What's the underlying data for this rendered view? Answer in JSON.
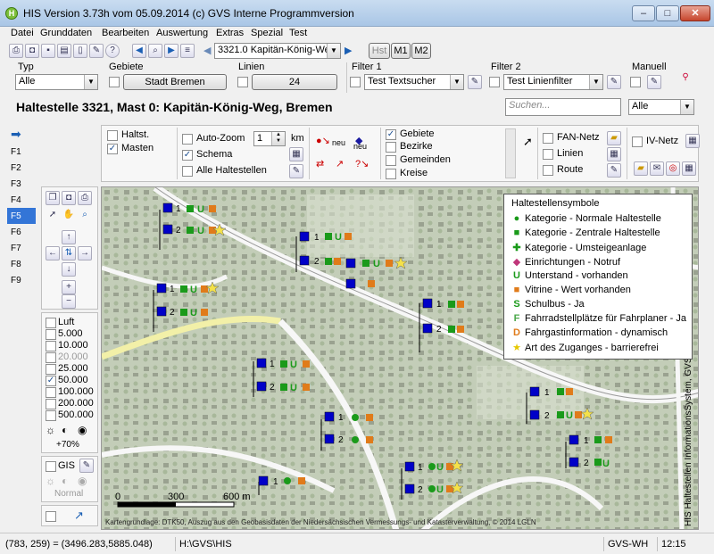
{
  "window": {
    "title": "HIS Version 3.73h vom 05.09.2014 (c) GVS Interne Programmversion",
    "icon_letter": "H",
    "controls": [
      "minimize-icon",
      "maximize-icon",
      "close-icon"
    ]
  },
  "menu": [
    "Datei",
    "Grunddaten",
    "Bearbeiten",
    "Auswertung",
    "Extras",
    "Spezial",
    "Test"
  ],
  "toolbar": {
    "stop_combo": "3321.0 Kapitän-König-Weg",
    "hst_label": "Hst",
    "m1_label": "M1",
    "m2_label": "M2"
  },
  "filters": {
    "typ_label": "Typ",
    "typ_value": "Alle",
    "gebiete_label": "Gebiete",
    "gebiete_button": "Stadt Bremen",
    "linien_label": "Linien",
    "linien_button": "24",
    "filter1_label": "Filter 1",
    "filter1_value": "Test Textsucher",
    "filter2_label": "Filter 2",
    "filter2_value": "Test Linienfilter",
    "manuell_label": "Manuell"
  },
  "heading": {
    "title": "Haltestelle 3321, Mast 0: Kapitän-König-Weg, Bremen",
    "search_placeholder": "Suchen...",
    "search_scope": "Alle"
  },
  "options": {
    "haltst": "Haltst.",
    "masten": "Masten",
    "autozoom": "Auto-Zoom",
    "zoom_value": "1",
    "zoom_unit": "km",
    "schema": "Schema",
    "alle_haltestellen": "Alle Haltestellen",
    "neu1": "neu",
    "neu2": "neu",
    "gebiete": "Gebiete",
    "bezirke": "Bezirke",
    "gemeinden": "Gemeinden",
    "kreise": "Kreise",
    "fan_netz": "FAN-Netz",
    "linien": "Linien",
    "route": "Route",
    "iv_netz": "IV-Netz"
  },
  "fkeys": [
    "F1",
    "F2",
    "F3",
    "F4",
    "F5",
    "F6",
    "F7",
    "F8",
    "F9"
  ],
  "active_fkey": "F5",
  "layers": [
    "Luft",
    "5.000",
    "10.000",
    "20.000",
    "25.000",
    "50.000",
    "100.000",
    "200.000",
    "500.000"
  ],
  "brightness": "+70%",
  "gis": {
    "label": "GIS",
    "mode": "Normal"
  },
  "map": {
    "scale_labels": [
      "0",
      "300",
      "600 m"
    ],
    "credit": "Kartengrundlage: DTK50, Auszug aus den Geobasisdaten der Niedersächsischen Vermessungs- und Katasterverwaltung, © 2014 LGLN",
    "side_text": "HIS Haltestellen InformationsSystem, GVS",
    "stop_numbers": [
      "1",
      "2"
    ],
    "colors": {
      "mast": "#0000c8",
      "unterstand": "#1a9a1a",
      "vitrine": "#e07b1a",
      "zugang": "#f4e14a"
    }
  },
  "legend": {
    "title": "Haltestellensymbole",
    "items": [
      {
        "icon": "green-circle-icon",
        "label": "Kategorie - Normale Haltestelle"
      },
      {
        "icon": "green-square-icon",
        "label": "Kategorie - Zentrale Haltestelle"
      },
      {
        "icon": "green-cross-icon",
        "label": "Kategorie - Umsteigeanlage"
      },
      {
        "icon": "pink-diamond-icon",
        "label": "Einrichtungen - Notruf"
      },
      {
        "symbol": "U",
        "label": "Unterstand - vorhanden"
      },
      {
        "icon": "orange-square-icon",
        "label": "Vitrine - Wert vorhanden"
      },
      {
        "symbol": "S",
        "label": "Schulbus - Ja"
      },
      {
        "symbol": "F",
        "label": "Fahrradstellplätze für Fahrplaner - Ja"
      },
      {
        "symbol": "D",
        "label": "Fahrgastinformation - dynamisch"
      },
      {
        "icon": "yellow-star-icon",
        "label": "Art des Zuganges - barrierefrei"
      }
    ]
  },
  "status": {
    "coords": "(783, 259) = (3496.283,5885.048)",
    "path": "H:\\GVS\\HIS",
    "user": "GVS-WH",
    "time": "12:15"
  }
}
